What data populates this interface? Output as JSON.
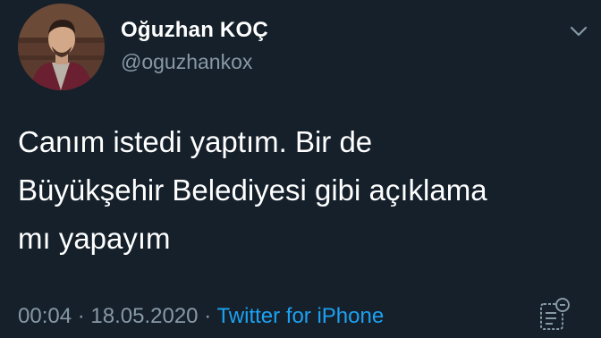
{
  "user": {
    "display_name": "Oğuzhan KOÇ",
    "handle": "@oguzhankox"
  },
  "tweet": {
    "lines": [
      "Canım istedi yaptım. Bir de",
      "Büyükşehir Belediyesi gibi açıklama",
      "mı yapayım"
    ]
  },
  "meta": {
    "time": "00:04",
    "separator": "·",
    "date": "18.05.2020",
    "source": "Twitter for iPhone"
  },
  "icons": {
    "more": "chevron-down-icon",
    "analytics": "analytics-icon"
  },
  "colors": {
    "background": "#15202b",
    "secondary_text": "#8899a6",
    "link": "#1da1f2"
  }
}
